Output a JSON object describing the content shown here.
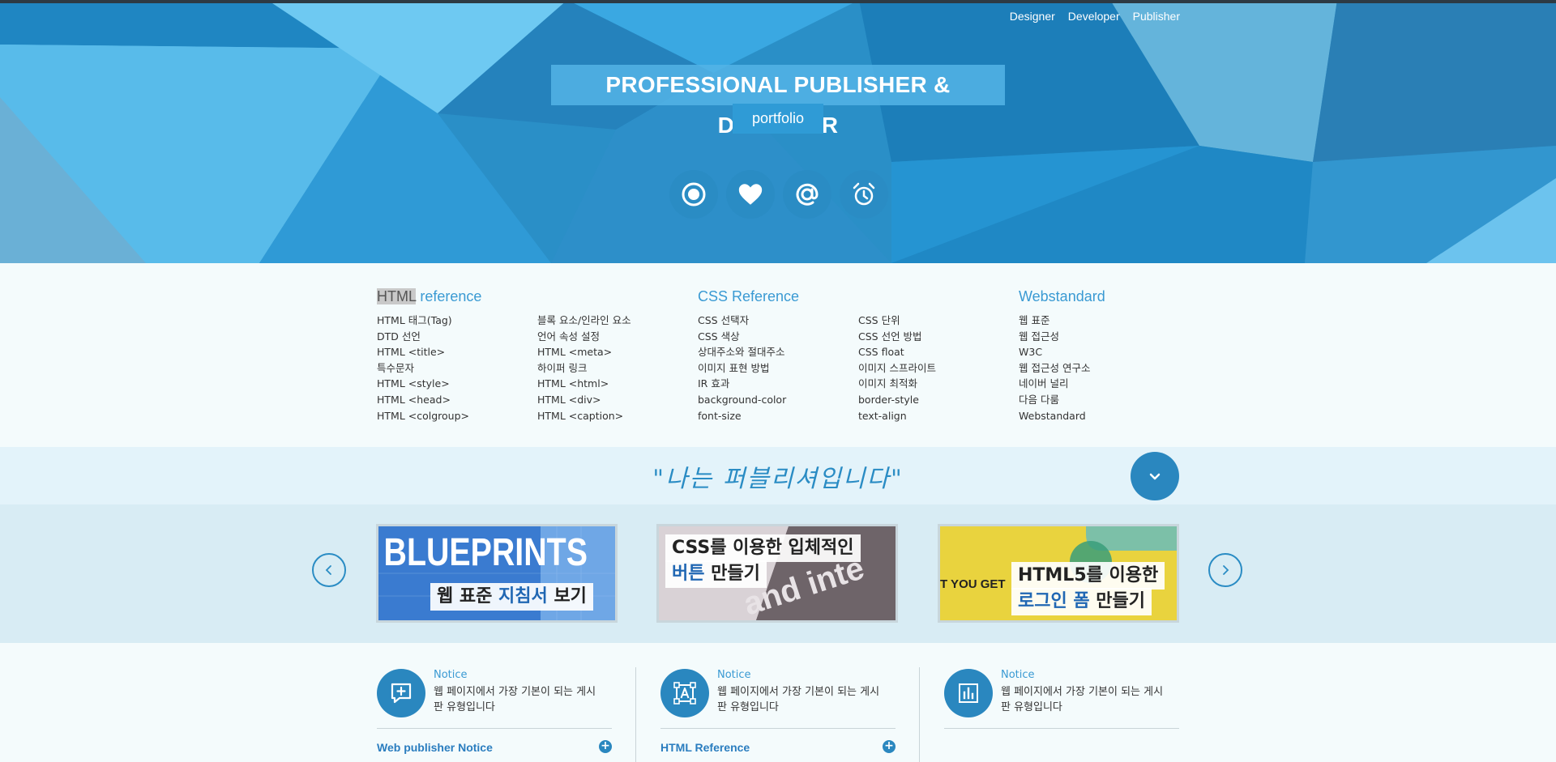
{
  "nav": {
    "items": [
      "Designer",
      "Developer",
      "Publisher"
    ]
  },
  "hero": {
    "title": "PROFESSIONAL PUBLISHER & DESIGNER",
    "subtitle": "portfolio",
    "icons": [
      "target-icon",
      "heart-icon",
      "at-icon",
      "alarm-icon"
    ],
    "accent": "#2a8cc4"
  },
  "references": [
    {
      "title_highlight": "HTML",
      "title_rest": " reference",
      "list1": [
        "HTML 태그(Tag)",
        "DTD 선언",
        "HTML <title>",
        "특수문자",
        "HTML <style>",
        "HTML <head>",
        "HTML <colgroup>"
      ],
      "list2": [
        "블록 요소/인라인 요소",
        "언어 속성 설정",
        "HTML <meta>",
        "하이퍼 링크",
        "HTML <html>",
        "HTML <div>",
        "HTML <caption>"
      ]
    },
    {
      "title": "CSS Reference",
      "list1": [
        "CSS 선택자",
        "CSS 색상",
        "상대주소와 절대주소",
        "이미지 표현 방법",
        "IR 효과",
        "background-color",
        "font-size"
      ],
      "list2": [
        "CSS 단위",
        "CSS 선언 방법",
        "CSS float",
        "이미지 스프라이트",
        "이미지 최적화",
        "border-style",
        "text-align"
      ]
    },
    {
      "title": "Webstandard",
      "list1": [
        "웹 표준",
        "웹 접근성",
        "W3C",
        "웹 접근성 연구소",
        "네이버 널리",
        "다음 다룸",
        "Webstandard"
      ]
    }
  ],
  "quote": "\"나는 퍼블리셔입니다\"",
  "carousel": {
    "cards": [
      {
        "bg_text": "BLUEPRINTS",
        "cap_1": "웹 표준 ",
        "cap_2": "지침서",
        "cap_3": " 보기"
      },
      {
        "bg_text": "and inte",
        "cap_line1": "CSS를 이용한 입체적인",
        "cap_2": "버튼",
        "cap_3": " 만들기"
      },
      {
        "bg_text": "T YOU GET",
        "cap_line1": "HTML5를 이용한",
        "cap_2": "로그인 폼",
        "cap_3": " 만들기"
      }
    ]
  },
  "notices": [
    {
      "tag": "Notice",
      "text": "웹 페이지에서 가장 기본이 되는 게시판 유형입니다",
      "link": "Web publisher Notice",
      "icon": "add-comment-icon"
    },
    {
      "tag": "Notice",
      "text": "웹 페이지에서 가장 기본이 되는 게시판 유형입니다",
      "link": "HTML Reference",
      "icon": "text-box-icon"
    },
    {
      "tag": "Notice",
      "text": "웹 페이지에서 가장 기본이 되는 게시판 유형입니다",
      "link": "",
      "icon": "bar-chart-icon"
    }
  ]
}
